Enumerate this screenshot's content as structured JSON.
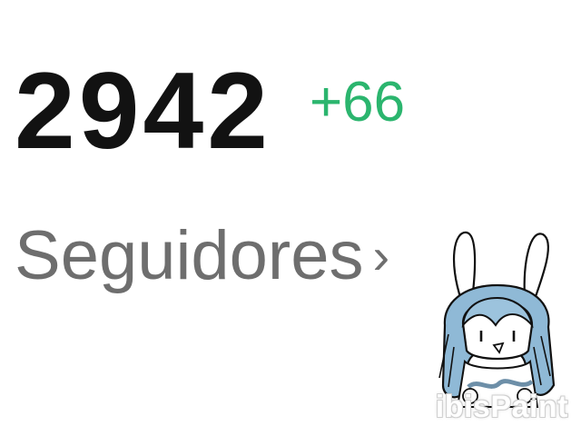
{
  "stats": {
    "follower_count": "2942",
    "follower_delta": "+66",
    "followers_label": "Seguidores",
    "chevron": "›"
  },
  "overlay": {
    "watermark": "ibisPaint",
    "mascot": "bunny-hood-drawing"
  },
  "colors": {
    "count": "#121212",
    "delta": "#2bb56e",
    "label": "#6e6e6e",
    "hood": "#8fb9d6"
  }
}
